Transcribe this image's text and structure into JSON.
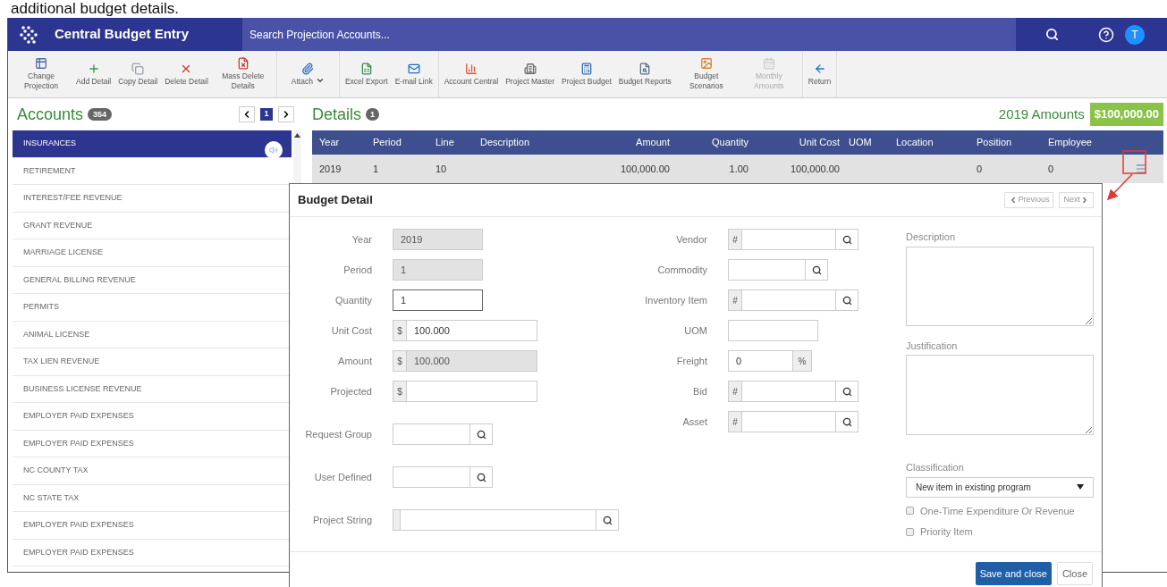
{
  "caption": "additional budget details.",
  "app": {
    "title": "Central Budget Entry",
    "search_placeholder": "Search Projection Accounts...",
    "avatar": "T"
  },
  "toolbar": {
    "groups": [
      [
        {
          "label": "Change Projection",
          "disabled": false,
          "has_menu": false
        },
        {
          "label": "Add Detail",
          "disabled": false,
          "has_menu": false
        },
        {
          "label": "Copy Detail",
          "disabled": false,
          "has_menu": false
        },
        {
          "label": "Delete Detail",
          "disabled": false,
          "has_menu": false
        },
        {
          "label": "Mass Delete Details",
          "disabled": false,
          "has_menu": false
        }
      ],
      [
        {
          "label": "Attach",
          "disabled": false,
          "has_menu": true
        }
      ],
      [
        {
          "label": "Excel Export",
          "disabled": false,
          "has_menu": false
        },
        {
          "label": "E-mail Link",
          "disabled": false,
          "has_menu": false
        }
      ],
      [
        {
          "label": "Account Central",
          "disabled": false,
          "has_menu": false
        },
        {
          "label": "Project Master",
          "disabled": false,
          "has_menu": false
        },
        {
          "label": "Project Budget",
          "disabled": false,
          "has_menu": false
        },
        {
          "label": "Budget Reports",
          "disabled": false,
          "has_menu": false
        },
        {
          "label": "Budget Scenarios",
          "disabled": false,
          "has_menu": false
        },
        {
          "label": "Monthly Amounts",
          "disabled": true,
          "has_menu": false
        }
      ],
      [
        {
          "label": "Return",
          "disabled": false,
          "has_menu": false
        }
      ]
    ]
  },
  "accounts": {
    "title": "Accounts",
    "count": "354",
    "page": "1",
    "items": [
      {
        "label": "INSURANCES",
        "selected": true
      },
      {
        "label": "RETIREMENT",
        "selected": false
      },
      {
        "label": "INTEREST/FEE REVENUE",
        "selected": false
      },
      {
        "label": "GRANT REVENUE",
        "selected": false
      },
      {
        "label": "MARRIAGE LICENSE",
        "selected": false
      },
      {
        "label": "GENERAL BILLING REVENUE",
        "selected": false
      },
      {
        "label": "PERMITS",
        "selected": false
      },
      {
        "label": "ANIMAL LICENSE",
        "selected": false
      },
      {
        "label": "TAX LIEN REVENUE",
        "selected": false
      },
      {
        "label": "BUSINESS LICENSE REVENUE",
        "selected": false
      },
      {
        "label": "EMPLOYER PAID EXPENSES",
        "selected": false
      },
      {
        "label": "EMPLOYER PAID EXPENSES",
        "selected": false
      },
      {
        "label": "NC COUNTY TAX",
        "selected": false
      },
      {
        "label": "NC STATE TAX",
        "selected": false
      },
      {
        "label": "EMPLOYER PAID EXPENSES",
        "selected": false
      },
      {
        "label": "EMPLOYER PAID EXPENSES",
        "selected": false
      }
    ]
  },
  "details": {
    "title": "Details",
    "count": "1",
    "amounts_label": "2019 Amounts",
    "amounts_value": "$100,000.00",
    "columns": [
      "Year",
      "Period",
      "Line",
      "Description",
      "Amount",
      "Quantity",
      "Unit Cost",
      "UOM",
      "Location",
      "Position",
      "Employee"
    ],
    "rows": [
      [
        "2019",
        "1",
        "10",
        "",
        "100,000.00",
        "1.00",
        "100,000.00",
        "",
        "",
        "0",
        "0"
      ]
    ]
  },
  "modal": {
    "title": "Budget Detail",
    "previous": "Previous",
    "next": "Next",
    "left_groups": [
      [
        {
          "label": "Year",
          "kind": "short",
          "value": "2019",
          "disabled": true,
          "focused": false
        },
        {
          "label": "Period",
          "kind": "short",
          "value": "1",
          "disabled": true,
          "focused": false
        },
        {
          "label": "Quantity",
          "kind": "short",
          "value": "1",
          "disabled": false,
          "focused": true
        },
        {
          "label": "Unit Cost",
          "kind": "prefixed",
          "prefix": "$",
          "value": "100.000",
          "disabled": false,
          "focused": false
        },
        {
          "label": "Amount",
          "kind": "prefixed",
          "prefix": "$",
          "value": "100.000",
          "disabled": true,
          "focused": false
        },
        {
          "label": "Projected",
          "kind": "prefixed",
          "prefix": "$",
          "disabled": false,
          "focused": false
        }
      ],
      [
        {
          "label": "Request Group",
          "kind": "lookup",
          "disabled": false,
          "focused": false
        },
        {
          "label": "User Defined",
          "kind": "lookup",
          "disabled": false,
          "focused": false
        }
      ],
      [
        {
          "label": "Project String",
          "kind": "wide_lookup",
          "disabled": false,
          "focused": false
        }
      ]
    ],
    "middle_fields": [
      {
        "label": "Vendor",
        "kind": "lookup",
        "prefix": "#",
        "disabled": false,
        "focused": false
      },
      {
        "label": "Commodity",
        "kind": "lookup",
        "disabled": false,
        "focused": false
      },
      {
        "label": "Inventory Item",
        "kind": "lookup",
        "prefix": "#",
        "disabled": false,
        "focused": false
      },
      {
        "label": "UOM",
        "kind": "short",
        "disabled": false,
        "focused": false
      },
      {
        "label": "Freight",
        "kind": "suffixed",
        "suffix": "%",
        "value": "0",
        "disabled": false,
        "focused": false
      },
      {
        "label": "Bid",
        "kind": "lookup",
        "prefix": "#",
        "disabled": false,
        "focused": false
      },
      {
        "label": "Asset",
        "kind": "lookup",
        "prefix": "#",
        "disabled": false,
        "focused": false
      }
    ],
    "description_label": "Description",
    "justification_label": "Justification",
    "classification_label": "Classification",
    "classification_value": "New item in existing program",
    "checkboxes": [
      {
        "label": "One-Time Expenditure Or Revenue",
        "checked": false
      },
      {
        "label": "Priority Item",
        "checked": false
      }
    ],
    "save_button": "Save and close",
    "close_button": "Close"
  }
}
